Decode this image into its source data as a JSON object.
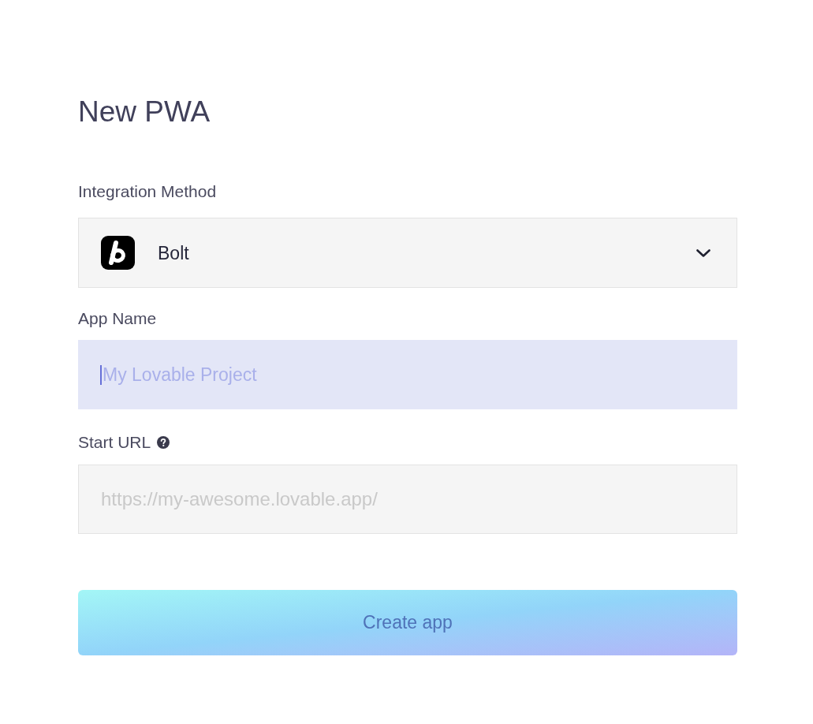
{
  "title": "New PWA",
  "integration_method": {
    "label": "Integration Method",
    "value": "Bolt"
  },
  "app_name": {
    "label": "App Name",
    "placeholder": "My Lovable Project",
    "focused": true
  },
  "start_url": {
    "label": "Start URL",
    "placeholder": "https://my-awesome.lovable.app/"
  },
  "create_button": {
    "label": "Create app",
    "disabled": true
  }
}
